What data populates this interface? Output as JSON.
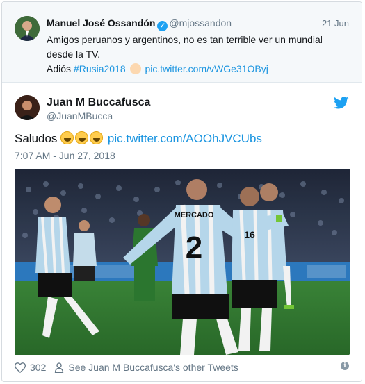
{
  "quoted": {
    "name": "Manuel José Ossandón",
    "handle": "@mjossandon",
    "date": "21 Jun",
    "text_line1": "Amigos peruanos y argentinos, no es tan terrible ver un mundial desde la TV.",
    "text_prefix": "Adiós",
    "hashtag": "#Rusia2018",
    "link": "pic.twitter.com/vWGe31OByj"
  },
  "tweet": {
    "name": "Juan M Buccafusca",
    "handle": "@JuanMBucca",
    "text": "Saludos",
    "link": "pic.twitter.com/AOOhJVCUbs",
    "timestamp": "7:07 AM - Jun 27, 2018",
    "player_number": "2",
    "player_name": "MERCADO",
    "player2_number": "16"
  },
  "footer": {
    "likes": "302",
    "other_tweets": "See Juan M Buccafusca's other Tweets"
  },
  "colors": {
    "link": "#1b95e0",
    "twitter_blue": "#1da1f2",
    "muted": "#657786"
  },
  "icons": [
    "verified-icon",
    "wave-emoji",
    "twitter-bird-icon",
    "laughing-emoji",
    "heart-icon",
    "person-icon",
    "info-icon"
  ]
}
